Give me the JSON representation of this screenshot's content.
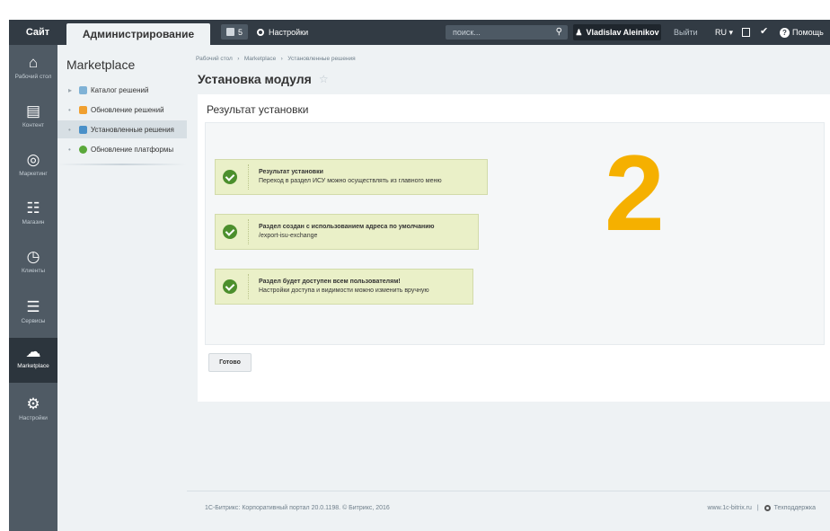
{
  "topbar": {
    "site_tab": "Сайт",
    "admin_tab": "Администрирование",
    "notifications_count": "5",
    "settings_label": "Настройки",
    "search_placeholder": "поиск...",
    "user_name": "Vladislav Aleinikov",
    "logout_label": "Выйти",
    "lang_label": "RU",
    "help_label": "Помощь"
  },
  "rail": {
    "items": [
      {
        "label": "Рабочий стол",
        "icon": "home-icon"
      },
      {
        "label": "Контент",
        "icon": "document-icon"
      },
      {
        "label": "Маркетинг",
        "icon": "target-icon"
      },
      {
        "label": "Магазин",
        "icon": "cart-icon"
      },
      {
        "label": "Клиенты",
        "icon": "clients-24-icon"
      },
      {
        "label": "Сервисы",
        "icon": "layers-icon"
      },
      {
        "label": "Marketplace",
        "icon": "cloud-download-icon"
      },
      {
        "label": "Настройки",
        "icon": "gear-icon"
      }
    ]
  },
  "sidebar": {
    "title": "Marketplace",
    "items": [
      {
        "label": "Каталог решений",
        "color": "#7fb2d6"
      },
      {
        "label": "Обновление решений",
        "color": "#f0a030"
      },
      {
        "label": "Установленные решения",
        "color": "#4a90c8"
      },
      {
        "label": "Обновление платформы",
        "color": "#5aa83a"
      }
    ]
  },
  "breadcrumbs": {
    "c1": "Рабочий стол",
    "c2": "Marketplace",
    "c3": "Установленные решения"
  },
  "page": {
    "title": "Установка модуля",
    "panel_title": "Результат установки",
    "big_number": "2",
    "done_button": "Готово",
    "messages": [
      {
        "title": "Результат установки",
        "text": "Переход в раздел ИСУ можно осуществлять из главного меню"
      },
      {
        "title": "Раздел создан с использованием адреса по умолчанию",
        "text": "/export-isu-exchange"
      },
      {
        "title": "Раздел будет доступен всем пользователям!",
        "text": "Настройки доступа и видимости можно изменить вручную"
      }
    ]
  },
  "footer": {
    "left": "1С-Битрикс: Корпоративный портал 20.0.1198. © Битрикс, 2016",
    "site_link": "www.1c-bitrix.ru",
    "support_label": "Техподдержка"
  },
  "colors": {
    "accent_number": "#f5b000",
    "success": "#4c8f2d",
    "topbar": "#323b44"
  }
}
